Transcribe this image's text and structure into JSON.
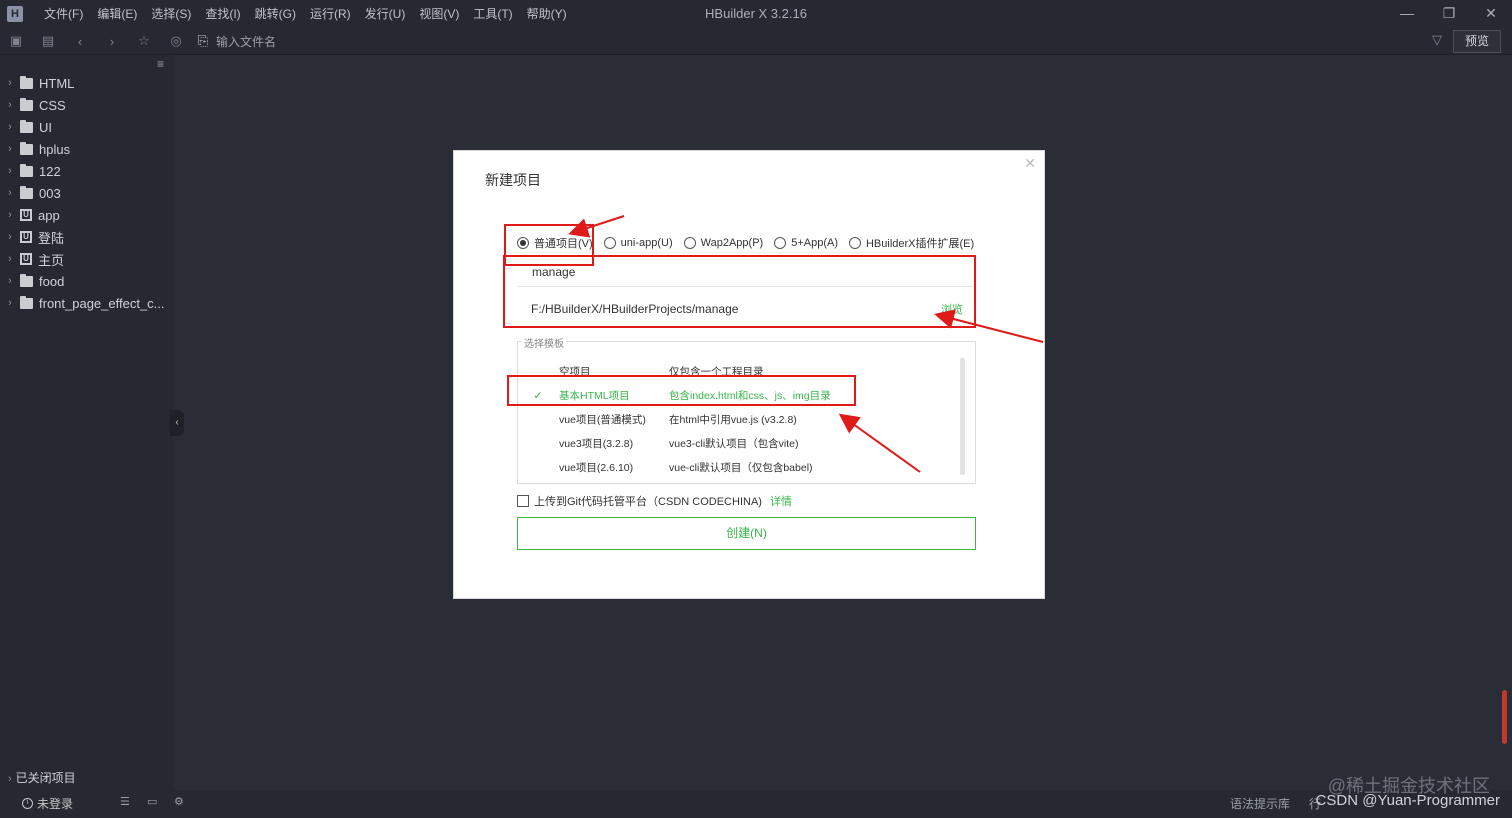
{
  "window": {
    "title": "HBuilder X 3.2.16",
    "menu": [
      "文件(F)",
      "编辑(E)",
      "选择(S)",
      "查找(I)",
      "跳转(G)",
      "运行(R)",
      "发行(U)",
      "视图(V)",
      "工具(T)",
      "帮助(Y)"
    ],
    "controls": {
      "minimize": "—",
      "maximize": "❐",
      "close": "✕"
    }
  },
  "toolbar": {
    "filename_placeholder": "输入文件名",
    "preview_label": "预览"
  },
  "sidebar": {
    "items": [
      {
        "label": "HTML",
        "icon": "folder-icon"
      },
      {
        "label": "CSS",
        "icon": "folder-icon"
      },
      {
        "label": "UI",
        "icon": "folder-icon"
      },
      {
        "label": "hplus",
        "icon": "folder-icon"
      },
      {
        "label": "122",
        "icon": "folder-icon"
      },
      {
        "label": "003",
        "icon": "folder-icon"
      },
      {
        "label": "app",
        "icon": "uniapp-icon"
      },
      {
        "label": "登陆",
        "icon": "uniapp-icon"
      },
      {
        "label": "主页",
        "icon": "uniapp-icon"
      },
      {
        "label": "food",
        "icon": "folder-icon"
      },
      {
        "label": "front_page_effect_c...",
        "icon": "folder-icon"
      }
    ],
    "closed_projects": "已关闭项目"
  },
  "dialog": {
    "title": "新建项目",
    "project_types": [
      {
        "label": "普通项目(V)",
        "selected": true
      },
      {
        "label": "uni-app(U)",
        "selected": false
      },
      {
        "label": "Wap2App(P)",
        "selected": false
      },
      {
        "label": "5+App(A)",
        "selected": false
      },
      {
        "label": "HBuilderX插件扩展(E)",
        "selected": false
      }
    ],
    "project_name": "manage",
    "project_path": "F:/HBuilderX/HBuilderProjects/manage",
    "browse_label": "浏览",
    "template_legend": "选择模板",
    "templates": [
      {
        "name": "空项目",
        "desc": "仅包含一个工程目录",
        "selected": false
      },
      {
        "name": "基本HTML项目",
        "desc": "包含index.html和css、js、img目录",
        "selected": true
      },
      {
        "name": "vue项目(普通模式)",
        "desc": "在html中引用vue.js (v3.2.8)",
        "selected": false
      },
      {
        "name": "vue3项目(3.2.8)",
        "desc": "vue3-cli默认项目（包含vite)",
        "selected": false
      },
      {
        "name": "vue项目(2.6.10)",
        "desc": "vue-cli默认项目（仅包含babel)",
        "selected": false
      }
    ],
    "git_label": "上传到Git代码托管平台（CSDN CODECHINA)",
    "git_link": "详情",
    "create_label": "创建(N)"
  },
  "statusbar": {
    "login": "未登录",
    "syntax_hint": "语法提示库",
    "line_prefix": "行",
    "watermark_top": "@稀土掘金技术社区",
    "watermark_bottom": "CSDN @Yuan-Programmer"
  },
  "colors": {
    "accent_green": "#39b54a",
    "annotation_red": "#e01919",
    "background": "#262932"
  }
}
